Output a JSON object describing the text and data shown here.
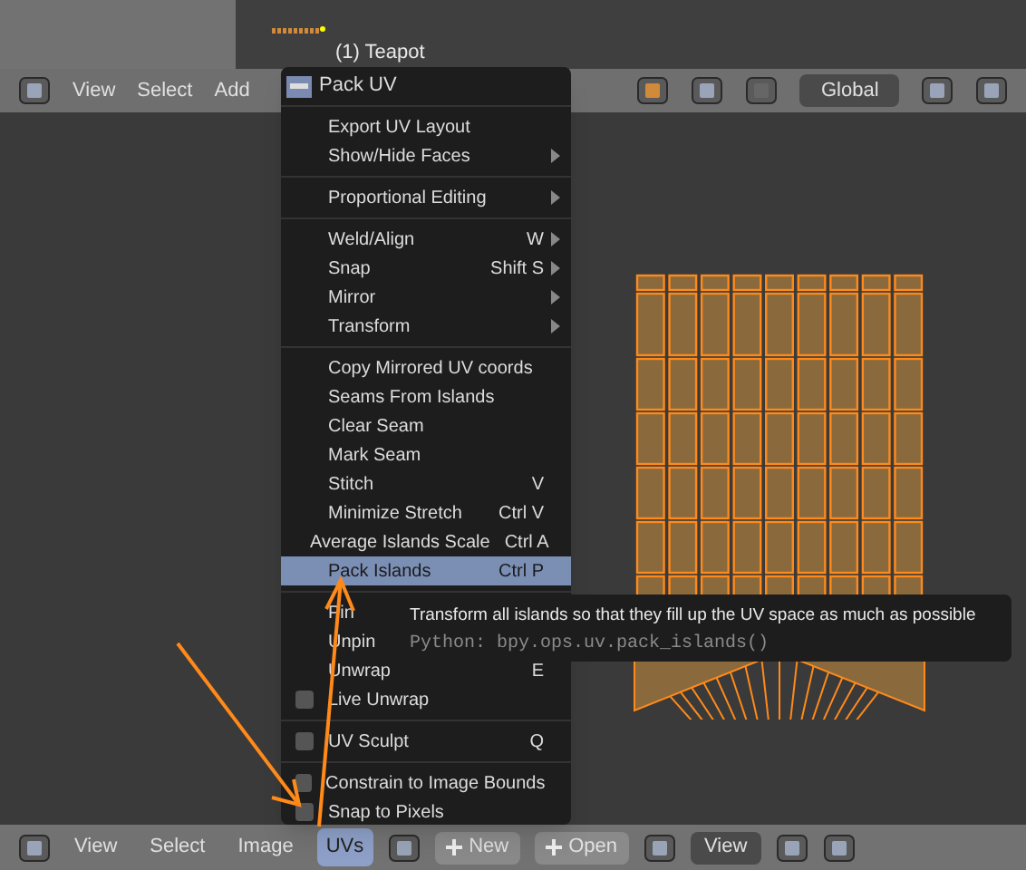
{
  "viewport": {
    "object_label": "(1) Teapot"
  },
  "top_header": {
    "menus": [
      {
        "label": "View",
        "selected": false
      },
      {
        "label": "Select",
        "selected": false
      },
      {
        "label": "Add",
        "selected": false
      }
    ],
    "orientation": "Global"
  },
  "menu": {
    "title": "Pack UV",
    "items": [
      {
        "kind": "item",
        "label": "Export UV Layout",
        "selected": false
      },
      {
        "kind": "submenu",
        "label": "Show/Hide Faces",
        "selected": false
      },
      {
        "kind": "separator"
      },
      {
        "kind": "submenu",
        "label": "Proportional Editing",
        "selected": false
      },
      {
        "kind": "separator"
      },
      {
        "kind": "submenu",
        "label": "Weld/Align",
        "shortcut": "W",
        "selected": false
      },
      {
        "kind": "submenu",
        "label": "Snap",
        "shortcut": "Shift S",
        "selected": false
      },
      {
        "kind": "submenu",
        "label": "Mirror",
        "selected": false
      },
      {
        "kind": "submenu",
        "label": "Transform",
        "selected": false
      },
      {
        "kind": "separator"
      },
      {
        "kind": "item",
        "label": "Copy Mirrored UV coords",
        "selected": false
      },
      {
        "kind": "item",
        "label": "Seams From Islands",
        "selected": false
      },
      {
        "kind": "item",
        "label": "Clear Seam",
        "selected": false
      },
      {
        "kind": "item",
        "label": "Mark Seam",
        "selected": false
      },
      {
        "kind": "item",
        "label": "Stitch",
        "shortcut": "V",
        "selected": false
      },
      {
        "kind": "item",
        "label": "Minimize Stretch",
        "shortcut": "Ctrl V",
        "selected": false
      },
      {
        "kind": "item",
        "label": "Average Islands Scale",
        "shortcut": "Ctrl A",
        "selected": false
      },
      {
        "kind": "item",
        "label": "Pack Islands",
        "shortcut": "Ctrl P",
        "selected": true
      },
      {
        "kind": "separator"
      },
      {
        "kind": "item",
        "label": "Pin",
        "selected": false
      },
      {
        "kind": "item",
        "label": "Unpin",
        "selected": false
      },
      {
        "kind": "item",
        "label": "Unwrap",
        "shortcut": "E",
        "selected": false
      },
      {
        "kind": "checkbox",
        "label": "Live Unwrap",
        "checked": false,
        "selected": false
      },
      {
        "kind": "separator"
      },
      {
        "kind": "checkbox",
        "label": "UV Sculpt",
        "shortcut": "Q",
        "checked": false,
        "selected": false
      },
      {
        "kind": "separator"
      },
      {
        "kind": "checkbox",
        "label": "Constrain to Image Bounds",
        "checked": false,
        "selected": false
      },
      {
        "kind": "checkbox",
        "label": "Snap to Pixels",
        "checked": false,
        "selected": false
      }
    ]
  },
  "tooltip": {
    "text": "Transform all islands so that they fill up the UV space as much as possible",
    "python": "Python: bpy.ops.uv.pack_islands()"
  },
  "bottom_header": {
    "menus": [
      {
        "label": "View",
        "selected": false
      },
      {
        "label": "Select",
        "selected": false
      },
      {
        "label": "Image",
        "selected": false
      },
      {
        "label": "UVs",
        "selected": true
      }
    ],
    "buttons": [
      "New",
      "Open"
    ],
    "view_mode": "View"
  }
}
